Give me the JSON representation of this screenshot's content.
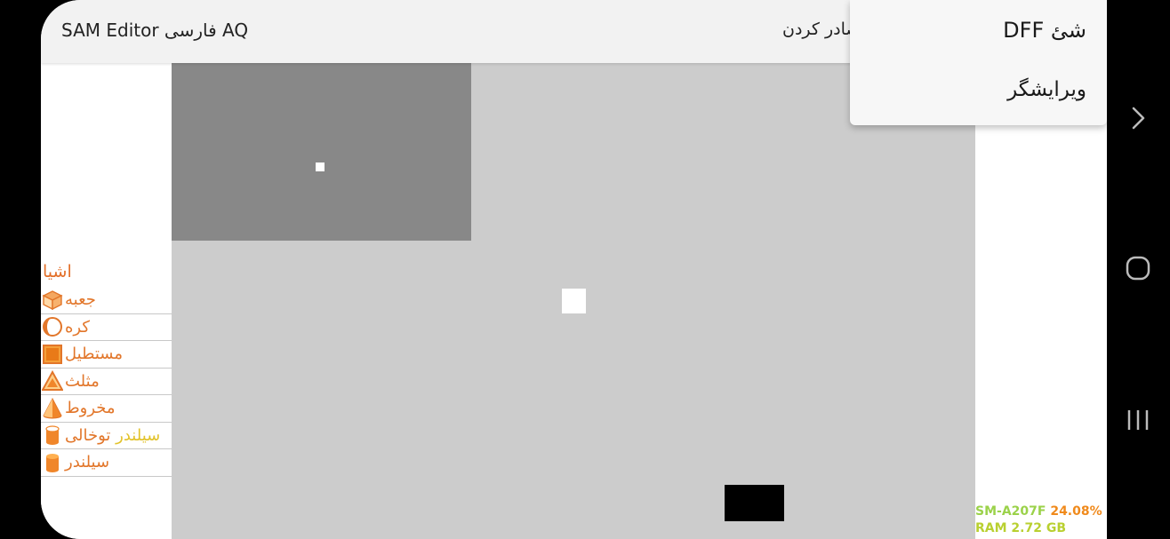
{
  "app": {
    "title": "SAM Editor فارسی AQ",
    "export_label": "صادر کردن"
  },
  "menu": {
    "items": [
      {
        "label": "شئ DFF"
      },
      {
        "label": "ویرایشگر"
      }
    ]
  },
  "objects_panel": {
    "title": "اشیا",
    "items": [
      {
        "label": "جعبه",
        "icon": "box-icon"
      },
      {
        "label": "کره",
        "icon": "sphere-icon"
      },
      {
        "label": "مستطیل",
        "icon": "rectangle-icon"
      },
      {
        "label": "مثلث",
        "icon": "triangle-icon"
      },
      {
        "label": "مخروط",
        "icon": "cone-icon"
      },
      {
        "label_part1": "سیلندر",
        "label_part2": "توخالی",
        "icon": "hollow-cylinder-icon"
      },
      {
        "label": "سیلندر",
        "icon": "cylinder-icon"
      }
    ]
  },
  "device_info": {
    "model": "SM-A207F",
    "cpu": "24.08%",
    "ram": "RAM 2.72 GB"
  },
  "nav": {
    "icons": [
      "chevron-right-icon",
      "home-icon",
      "recents-icon"
    ]
  },
  "colors": {
    "accent_orange": "#e2762a",
    "viewport_bg": "#cccccc",
    "dark_panel": "#888888",
    "device_green": "#9bd24a",
    "cpu_orange": "#f08a1c"
  }
}
